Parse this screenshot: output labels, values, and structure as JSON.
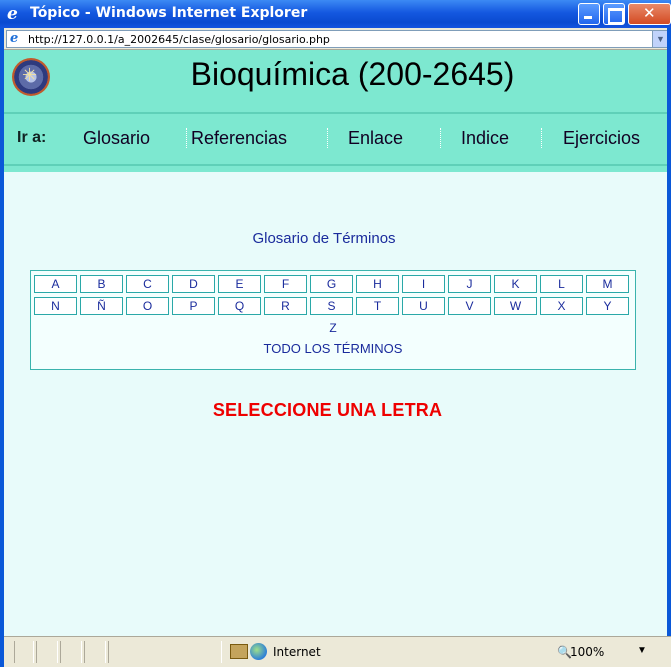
{
  "window": {
    "title": "Tópico - Windows Internet Explorer",
    "url": "http://127.0.0.1/a_2002645/clase/glosario/glosario.php"
  },
  "page": {
    "site_title": "Bioquímica (200-2645)",
    "nav": {
      "label": "Ir a:",
      "items": [
        "Glosario",
        "Referencias",
        "Enlace",
        "Indice",
        "Ejercicios"
      ]
    },
    "glossary": {
      "heading": "Glosario de Términos",
      "row1": [
        "A",
        "B",
        "C",
        "D",
        "E",
        "F",
        "G",
        "H",
        "I",
        "J",
        "K",
        "L",
        "M"
      ],
      "row2": [
        "N",
        "Ñ",
        "O",
        "P",
        "Q",
        "R",
        "S",
        "T",
        "U",
        "V",
        "W",
        "X",
        "Y"
      ],
      "last_letter": "Z",
      "all_terms": "TODO LOS TÉRMINOS"
    },
    "message": "SELECCIONE UNA LETRA"
  },
  "statusbar": {
    "zone": "Internet",
    "zoom": "100%"
  },
  "colors": {
    "header_bg": "#7de8d0",
    "content_bg": "#e8fbfa",
    "link_text": "#1a2b9c",
    "message": "#ee0000"
  }
}
